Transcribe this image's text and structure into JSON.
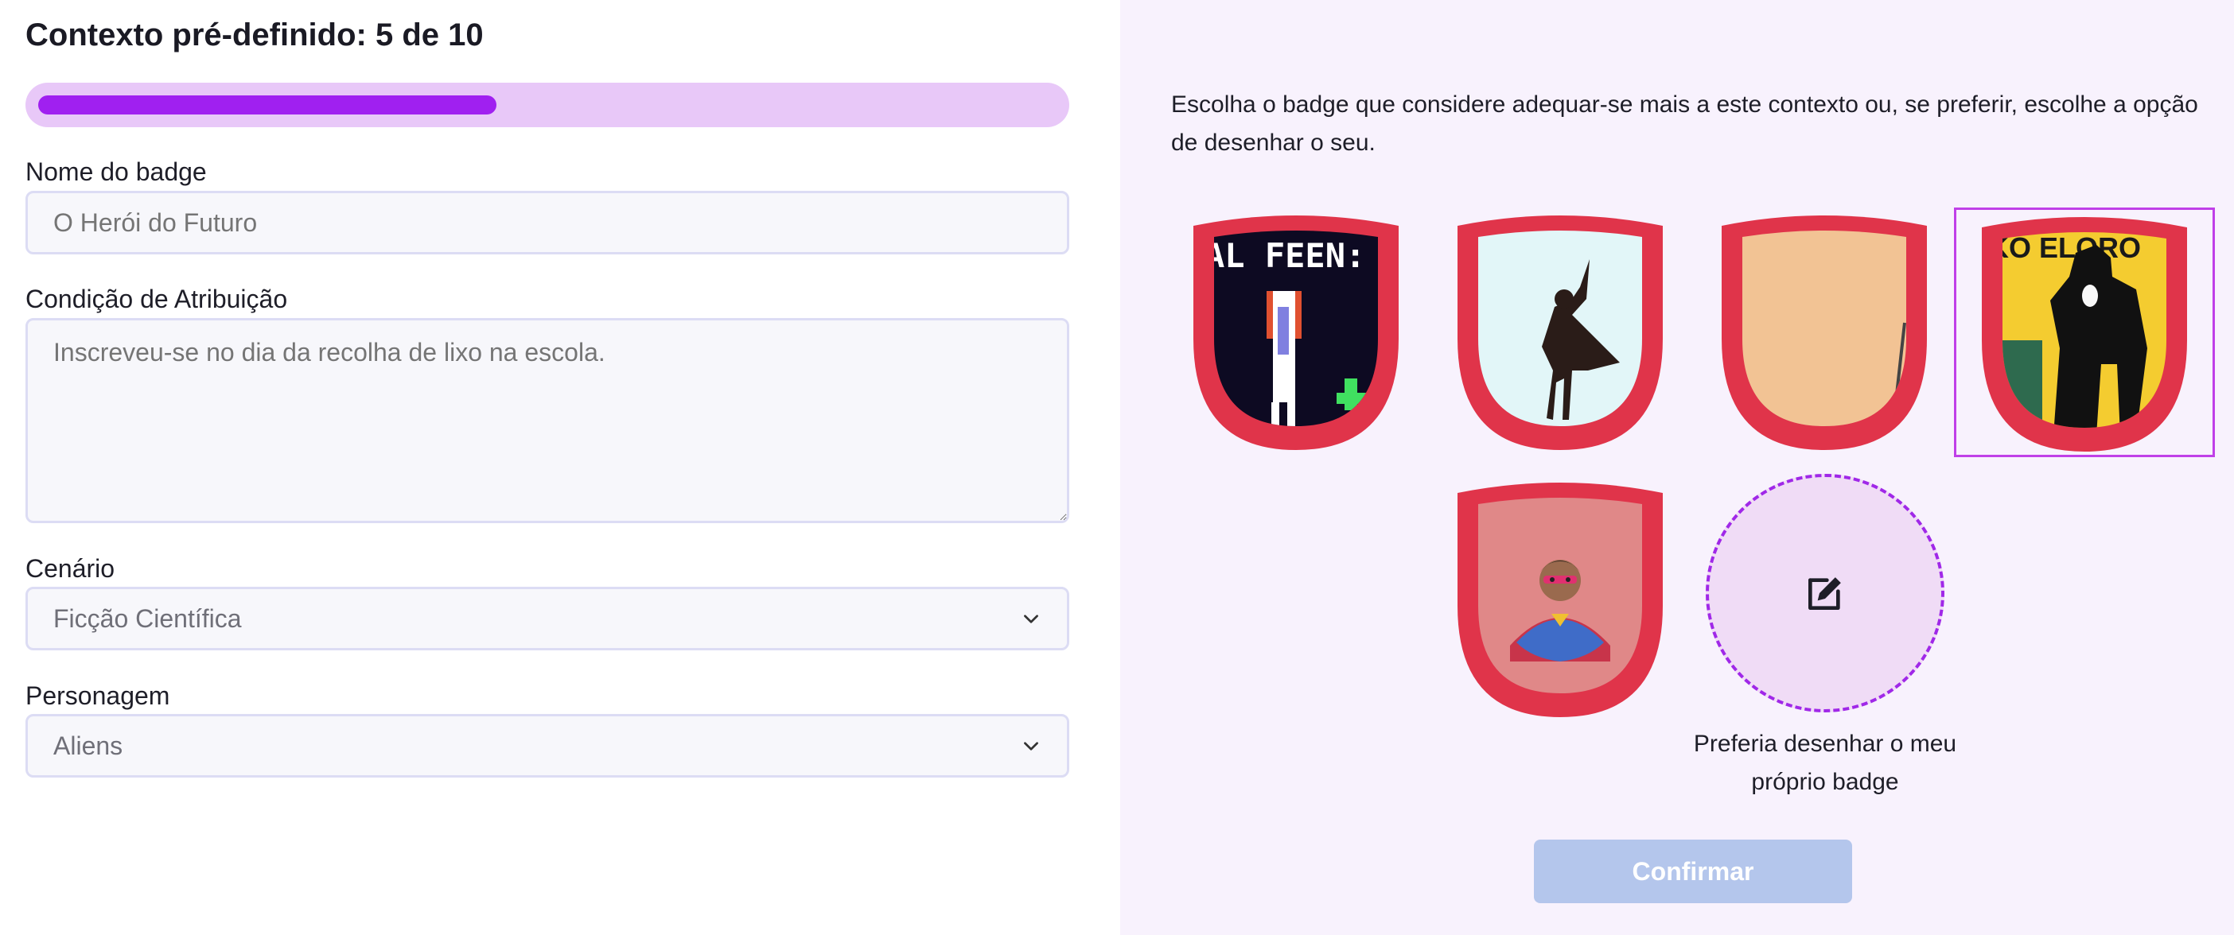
{
  "header": {
    "title": "Contexto pré-definido: 5 de 10"
  },
  "progress": {
    "current": 5,
    "total": 10,
    "fraction": 0.45
  },
  "form": {
    "name_label": "Nome do badge",
    "name_placeholder": "O Herói do Futuro",
    "condition_label": "Condição de Atribuição",
    "condition_placeholder": "Inscreveu-se no dia da recolha de lixo na escola.",
    "scenario_label": "Cenário",
    "scenario_value": "Ficção Científica",
    "character_label": "Personagem",
    "character_value": "Aliens"
  },
  "badges": {
    "description": "Escolha o badge que considere adequar-se mais a este contexto ou, se preferir, escolhe a opção de desenhar o seu.",
    "items": [
      {
        "name": "badge-pixel-hero",
        "art_text": "AL FEEN:",
        "selected": false
      },
      {
        "name": "badge-silhouette-caped",
        "selected": false
      },
      {
        "name": "badge-peach",
        "selected": false
      },
      {
        "name": "badge-superhero-poster",
        "art_text": "KO ELORO",
        "selected": true
      },
      {
        "name": "badge-emoji-superhero",
        "selected": false
      }
    ],
    "draw_own_label": "Preferia desenhar o meu próprio badge"
  },
  "actions": {
    "confirm_label": "Confirmar"
  },
  "colors": {
    "accent": "#a020f0",
    "progress_track": "#e8c8f8",
    "badge_rim": "#e0344a",
    "panel_bg": "#f8f2fd",
    "confirm_disabled": "#b4c6ec"
  }
}
